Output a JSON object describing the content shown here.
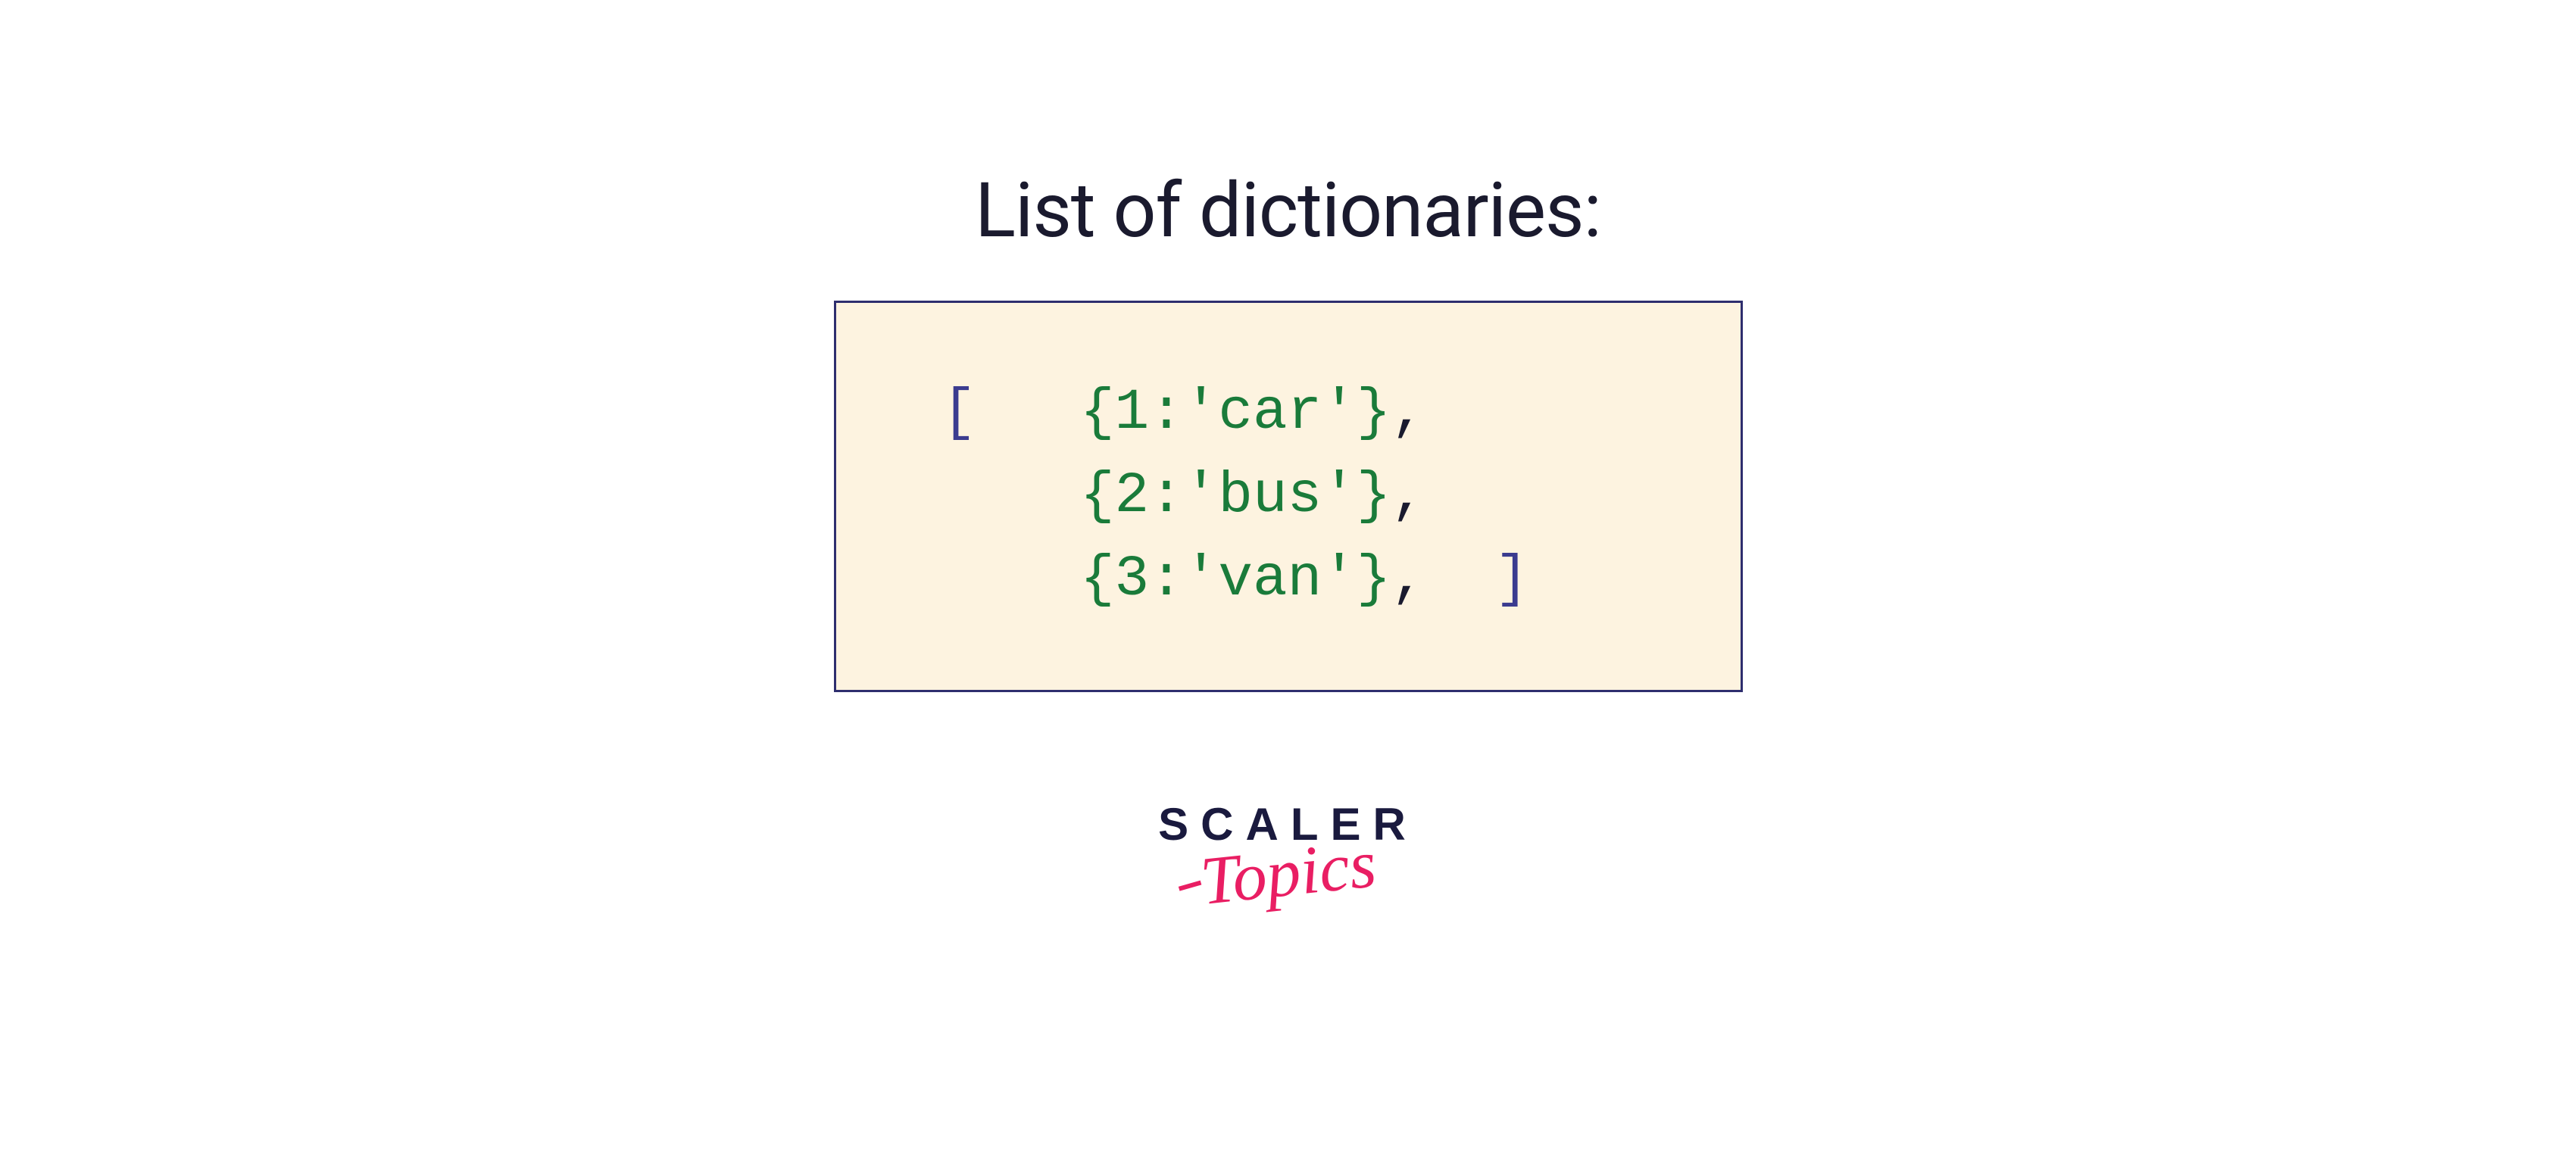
{
  "title": "List of dictionaries:",
  "code": {
    "open_bracket": "[",
    "close_bracket": "]",
    "entries": [
      {
        "dict": "{1:'car'}",
        "comma": ","
      },
      {
        "dict": "{2:'bus'}",
        "comma": ","
      },
      {
        "dict": "{3:'van'}",
        "comma": ","
      }
    ]
  },
  "logo": {
    "main": "SCALER",
    "sub": "Topics"
  },
  "colors": {
    "bracket": "#3b3b8f",
    "dict": "#1a7b3a",
    "box_bg": "#fdf3e0",
    "box_border": "#2e2e6e",
    "title": "#1a1a2e",
    "logo_main": "#1a1a3e",
    "logo_accent": "#e91e63"
  }
}
